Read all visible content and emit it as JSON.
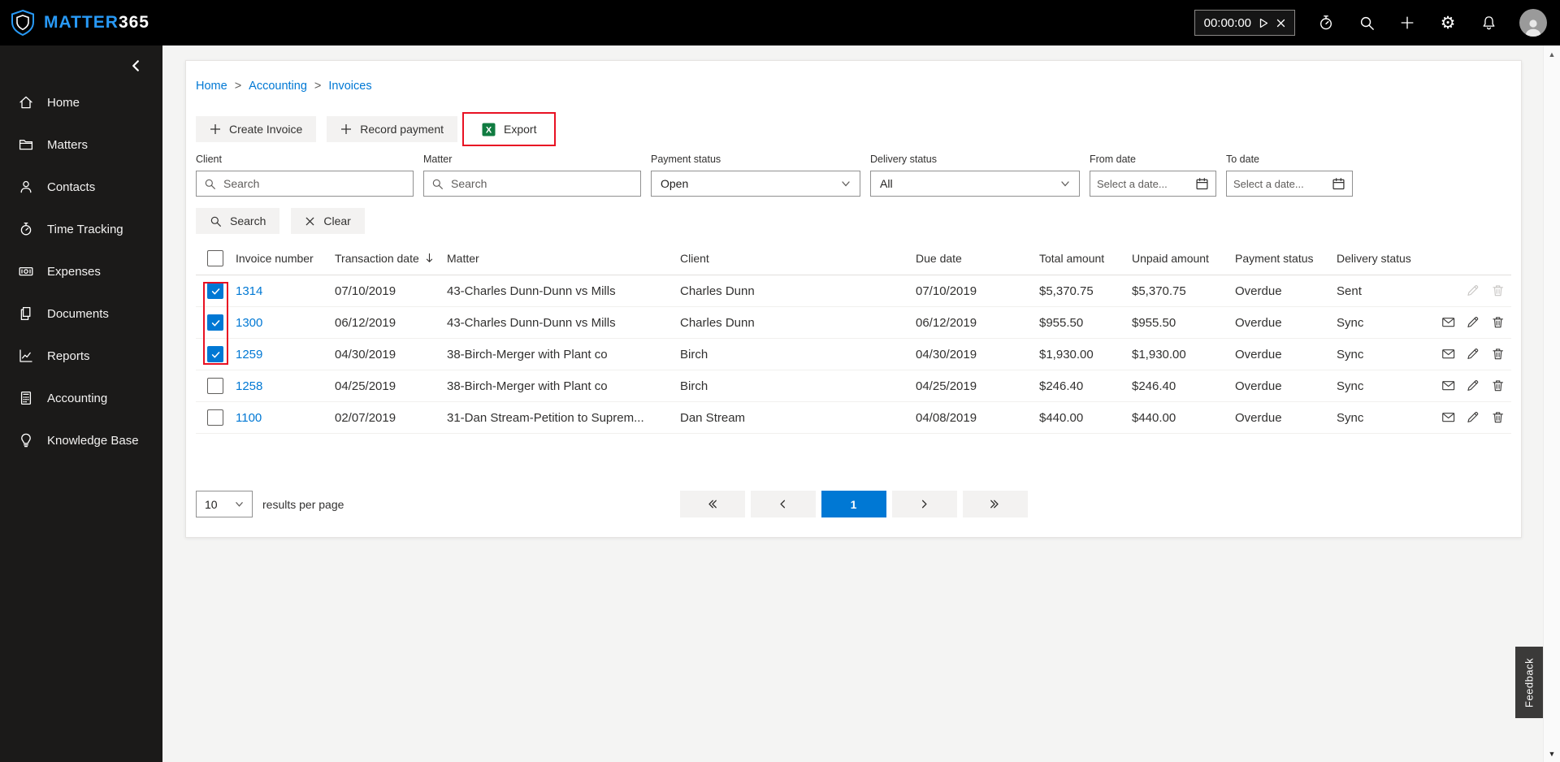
{
  "topbar": {
    "brand_primary": "MATTER",
    "brand_secondary": "365",
    "timer_value": "00:00:00",
    "icons": [
      "timer-play-icon",
      "timer-close-icon",
      "stopwatch-icon",
      "search-icon",
      "add-icon",
      "settings-gear-icon",
      "notifications-bell-icon",
      "avatar"
    ]
  },
  "sidebar": {
    "items": [
      {
        "label": "Home",
        "icon": "home-icon"
      },
      {
        "label": "Matters",
        "icon": "folder-icon"
      },
      {
        "label": "Contacts",
        "icon": "person-icon"
      },
      {
        "label": "Time Tracking",
        "icon": "stopwatch-icon"
      },
      {
        "label": "Expenses",
        "icon": "banknote-icon"
      },
      {
        "label": "Documents",
        "icon": "documents-icon"
      },
      {
        "label": "Reports",
        "icon": "chart-icon"
      },
      {
        "label": "Accounting",
        "icon": "calculator-icon"
      },
      {
        "label": "Knowledge Base",
        "icon": "lightbulb-icon"
      }
    ]
  },
  "breadcrumb": {
    "items": [
      "Home",
      "Accounting",
      "Invoices"
    ],
    "separator": ">"
  },
  "toolbar": {
    "create_invoice_label": "Create Invoice",
    "record_payment_label": "Record payment",
    "export_label": "Export"
  },
  "filters": {
    "client_label": "Client",
    "client_placeholder": "Search",
    "matter_label": "Matter",
    "matter_placeholder": "Search",
    "payment_status_label": "Payment status",
    "payment_status_value": "Open",
    "delivery_status_label": "Delivery status",
    "delivery_status_value": "All",
    "from_date_label": "From date",
    "from_date_placeholder": "Select a date...",
    "to_date_label": "To date",
    "to_date_placeholder": "Select a date...",
    "search_button_label": "Search",
    "clear_button_label": "Clear"
  },
  "table": {
    "headers": {
      "invoice_number": "Invoice number",
      "transaction_date": "Transaction date",
      "matter": "Matter",
      "client": "Client",
      "due_date": "Due date",
      "total_amount": "Total amount",
      "unpaid_amount": "Unpaid amount",
      "payment_status": "Payment status",
      "delivery_status": "Delivery status"
    },
    "sort_column": "Transaction date",
    "sort_direction": "descending",
    "rows": [
      {
        "checked": true,
        "invoice_number": "1314",
        "transaction_date": "07/10/2019",
        "matter": "43-Charles Dunn-Dunn vs Mills",
        "client": "Charles Dunn",
        "due_date": "07/10/2019",
        "total_amount": "$5,370.75",
        "unpaid_amount": "$5,370.75",
        "payment_status": "Overdue",
        "delivery_status": "Sent",
        "has_mail": false,
        "actions_disabled": true
      },
      {
        "checked": true,
        "invoice_number": "1300",
        "transaction_date": "06/12/2019",
        "matter": "43-Charles Dunn-Dunn vs Mills",
        "client": "Charles Dunn",
        "due_date": "06/12/2019",
        "total_amount": "$955.50",
        "unpaid_amount": "$955.50",
        "payment_status": "Overdue",
        "delivery_status": "Sync",
        "has_mail": true,
        "actions_disabled": false
      },
      {
        "checked": true,
        "invoice_number": "1259",
        "transaction_date": "04/30/2019",
        "matter": "38-Birch-Merger with Plant co",
        "client": "Birch",
        "due_date": "04/30/2019",
        "total_amount": "$1,930.00",
        "unpaid_amount": "$1,930.00",
        "payment_status": "Overdue",
        "delivery_status": "Sync",
        "has_mail": true,
        "actions_disabled": false
      },
      {
        "checked": false,
        "invoice_number": "1258",
        "transaction_date": "04/25/2019",
        "matter": "38-Birch-Merger with Plant co",
        "client": "Birch",
        "due_date": "04/25/2019",
        "total_amount": "$246.40",
        "unpaid_amount": "$246.40",
        "payment_status": "Overdue",
        "delivery_status": "Sync",
        "has_mail": true,
        "actions_disabled": false
      },
      {
        "checked": false,
        "invoice_number": "1100",
        "transaction_date": "02/07/2019",
        "matter": "31-Dan Stream-Petition to Suprem...",
        "client": "Dan Stream",
        "due_date": "04/08/2019",
        "total_amount": "$440.00",
        "unpaid_amount": "$440.00",
        "payment_status": "Overdue",
        "delivery_status": "Sync",
        "has_mail": true,
        "actions_disabled": false
      }
    ]
  },
  "pagination": {
    "per_page_value": "10",
    "per_page_label": "results per page",
    "current_page": "1"
  },
  "feedback_label": "Feedback",
  "colors": {
    "accent": "#0078d4",
    "annotation_red": "#e81123",
    "topbar_bg": "#000000",
    "sidebar_bg": "#1b1a19"
  }
}
